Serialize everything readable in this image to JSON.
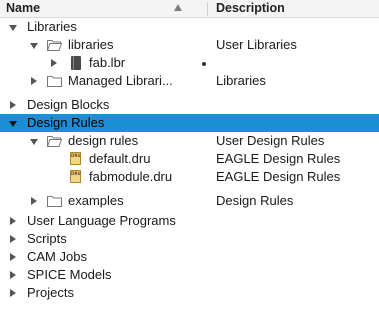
{
  "header": {
    "name_label": "Name",
    "description_label": "Description"
  },
  "tree": {
    "libraries": {
      "label": "Libraries",
      "description": ""
    },
    "libraries_folder": {
      "label": "libraries",
      "description": "User Libraries"
    },
    "fab_lbr": {
      "label": "fab.lbr",
      "description": ""
    },
    "managed_libraries": {
      "label": "Managed Librari...",
      "description": "Libraries"
    },
    "design_blocks": {
      "label": "Design Blocks",
      "description": ""
    },
    "design_rules": {
      "label": "Design Rules",
      "description": ""
    },
    "design_rules_folder": {
      "label": "design rules",
      "description": "User Design Rules"
    },
    "default_dru": {
      "label": "default.dru",
      "description": "EAGLE Design Rules"
    },
    "fabmodule_dru": {
      "label": "fabmodule.dru",
      "description": "EAGLE Design Rules"
    },
    "examples": {
      "label": "examples",
      "description": "Design Rules"
    },
    "ulp": {
      "label": "User Language Programs",
      "description": ""
    },
    "scripts": {
      "label": "Scripts",
      "description": ""
    },
    "cam_jobs": {
      "label": "CAM Jobs",
      "description": ""
    },
    "spice_models": {
      "label": "SPICE Models",
      "description": ""
    },
    "projects": {
      "label": "Projects",
      "description": ""
    }
  },
  "icons": {
    "folder": "folder-icon",
    "open_folder": "open-folder-icon",
    "library_file": "library-file-icon",
    "dru_file": "dru-file-icon"
  },
  "colors": {
    "selection": "#1a8fd6",
    "header_bg": "#f4f4f4"
  }
}
